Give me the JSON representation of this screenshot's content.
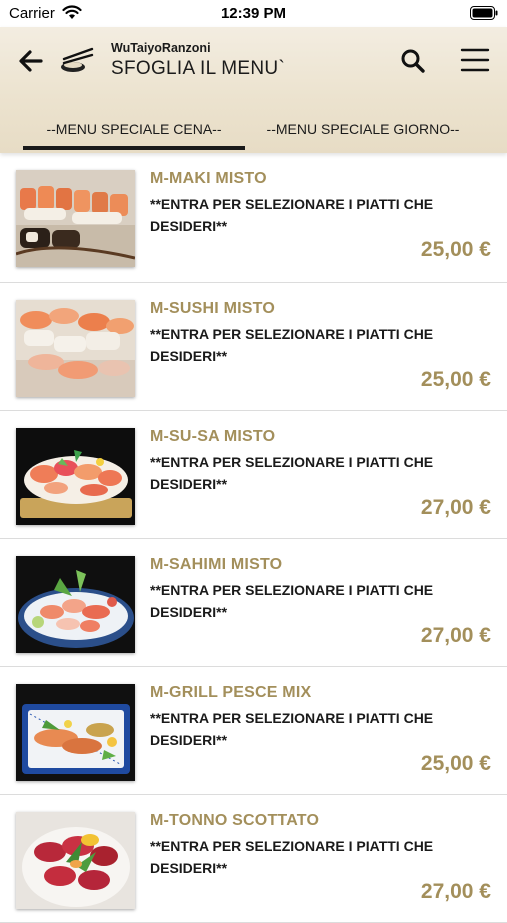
{
  "status_bar": {
    "carrier": "Carrier",
    "time": "12:39 PM"
  },
  "header": {
    "subtitle": "WuTaiyoRanzoni",
    "title": "SFOGLIA IL MENU`",
    "icons": [
      "back-arrow-icon",
      "logo-icon",
      "search-icon",
      "hamburger-menu-icon"
    ]
  },
  "tabs": [
    {
      "label": "--MENU SPECIALE CENA--",
      "selected": true
    },
    {
      "label": "--MENU SPECIALE GIORNO--",
      "selected": false
    }
  ],
  "items": [
    {
      "name": "M-MAKI MISTO",
      "desc": "**ENTRA PER SELEZIONARE I PIATTI CHE DESIDERI**",
      "price": "25,00 €"
    },
    {
      "name": "M-SUSHI MISTO",
      "desc": "**ENTRA PER SELEZIONARE I PIATTI CHE DESIDERI**",
      "price": "25,00 €"
    },
    {
      "name": "M-SU-SA MISTO",
      "desc": "**ENTRA PER SELEZIONARE I PIATTI CHE DESIDERI**",
      "price": "27,00 €"
    },
    {
      "name": "M-SAHIMI MISTO",
      "desc": "**ENTRA PER SELEZIONARE I PIATTI CHE DESIDERI**",
      "price": "27,00 €"
    },
    {
      "name": "M-GRILL PESCE MIX",
      "desc": "**ENTRA PER SELEZIONARE I PIATTI CHE DESIDERI**",
      "price": "25,00 €"
    },
    {
      "name": "M-TONNO SCOTTATO",
      "desc": "**ENTRA PER SELEZIONARE I PIATTI CHE DESIDERI**",
      "price": "27,00 €"
    }
  ],
  "colors": {
    "accent_gold": "#a38f5b",
    "header_bg": "#ece3cf"
  }
}
